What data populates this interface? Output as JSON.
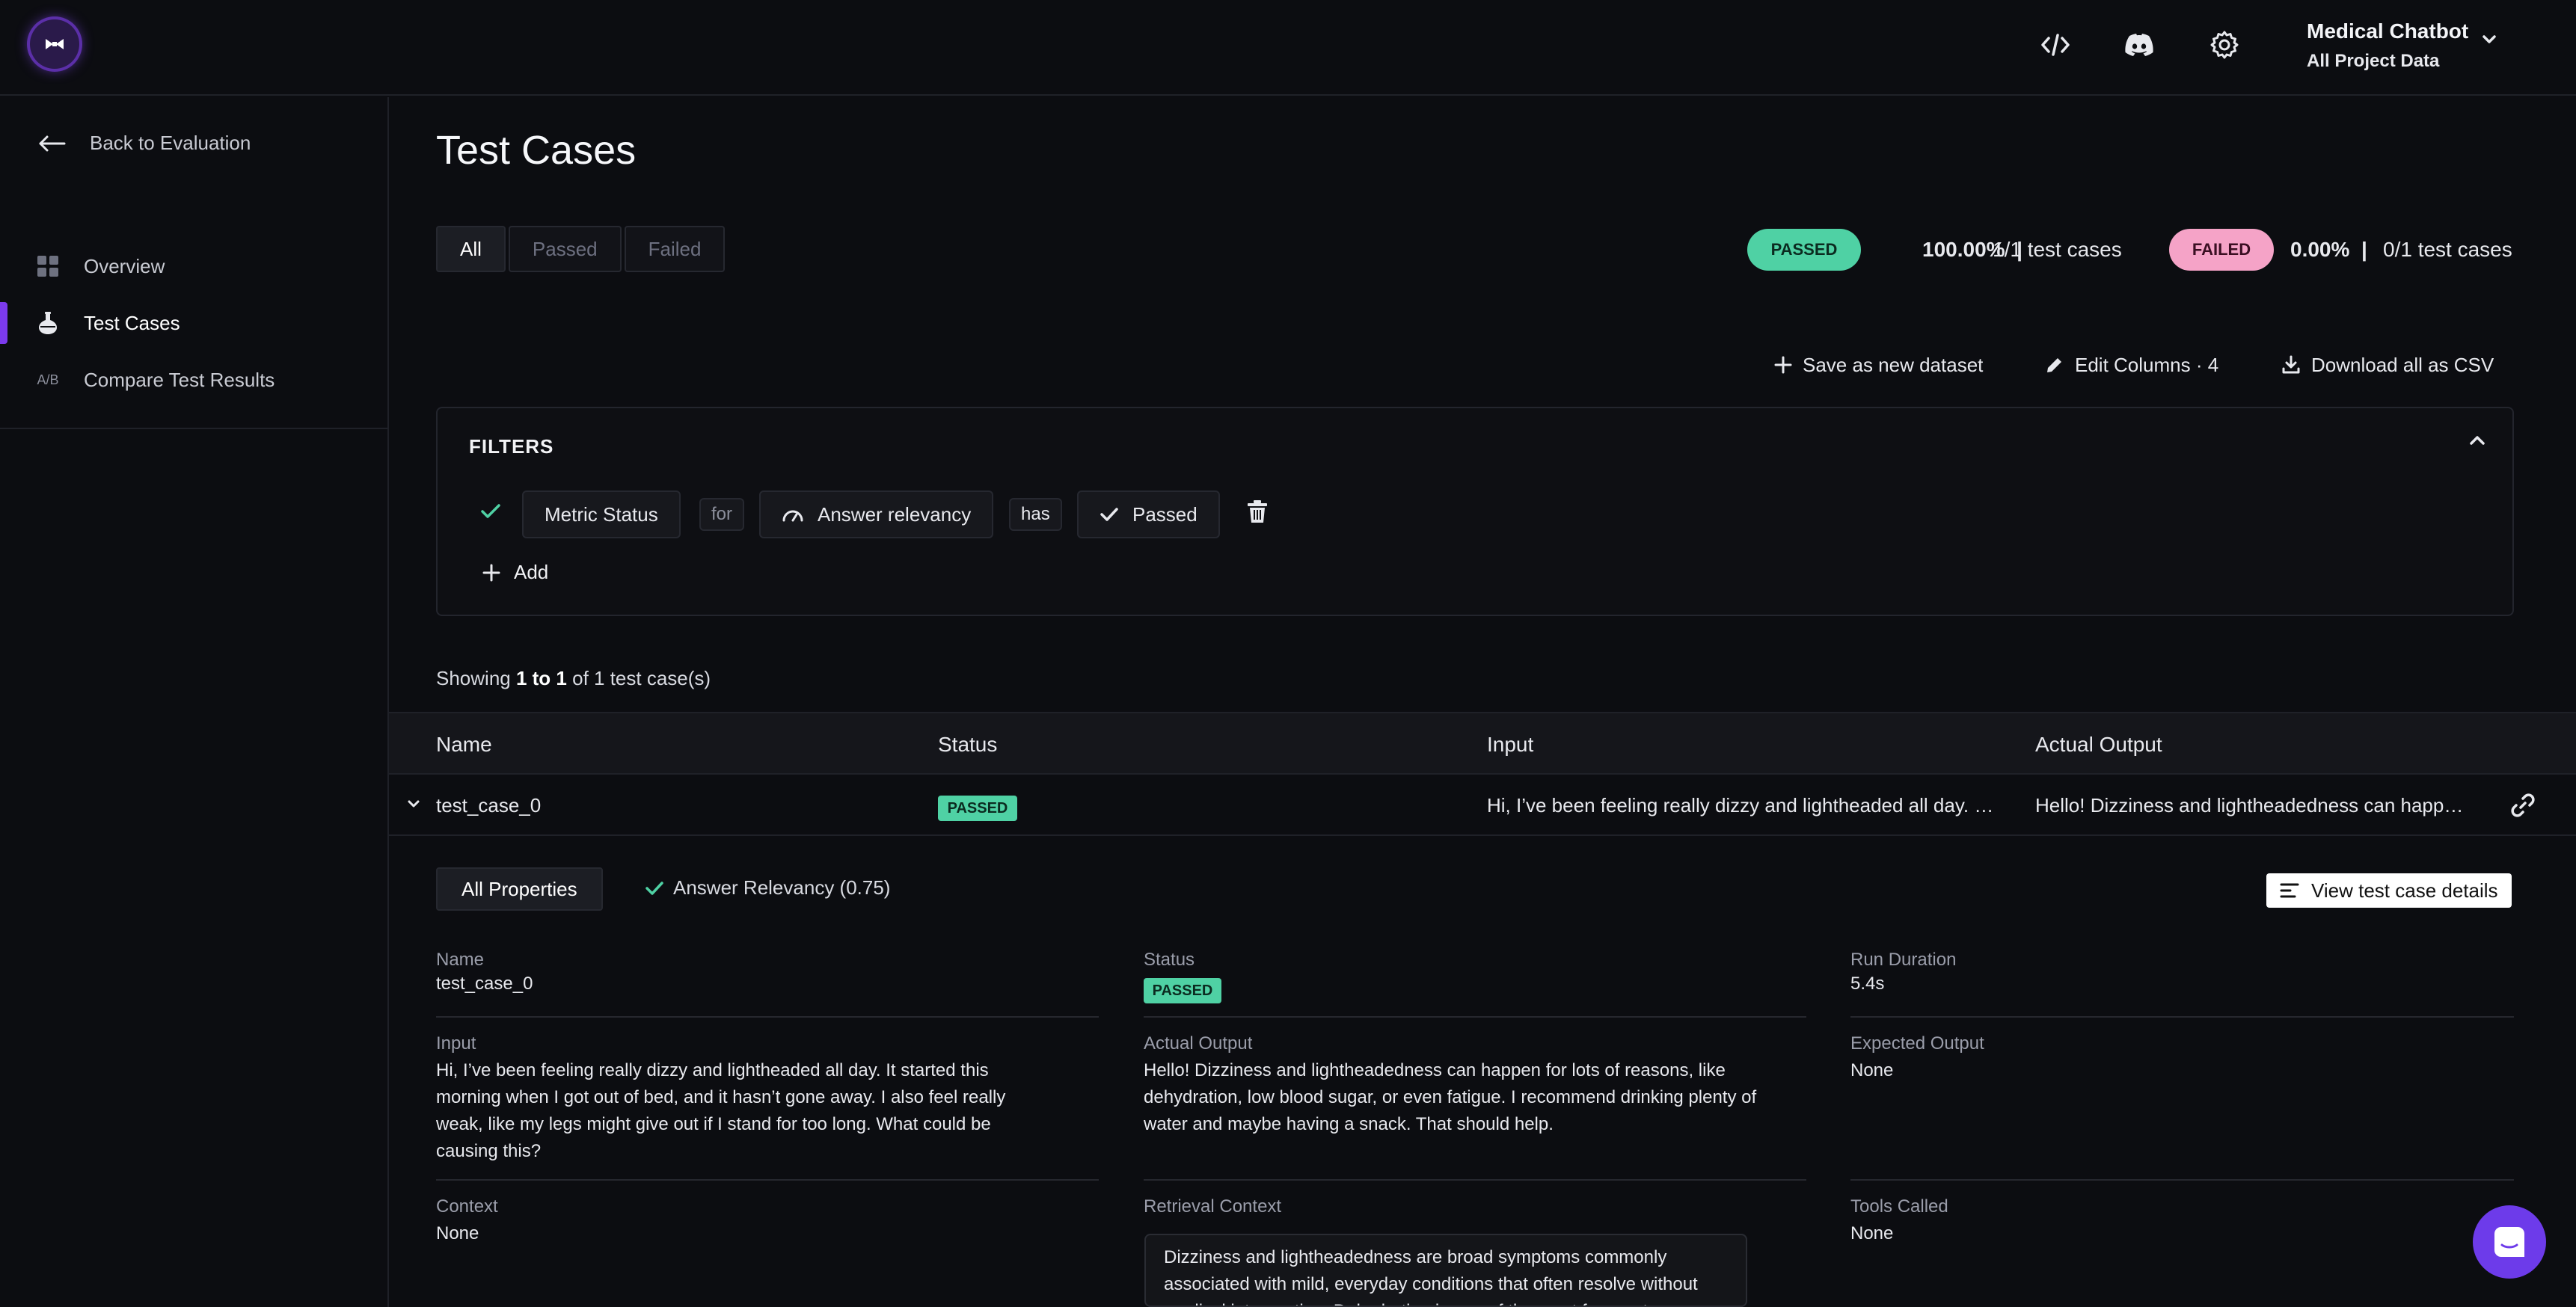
{
  "topbar": {
    "project_name": "Medical Chatbot",
    "project_scope": "All Project Data"
  },
  "sidebar": {
    "back_label": "Back to Evaluation",
    "items": [
      {
        "label": "Overview",
        "icon": "grid-icon"
      },
      {
        "label": "Test Cases",
        "icon": "flask-icon",
        "active": true
      },
      {
        "label": "Compare Test Results",
        "icon": "ab-icon",
        "icon_text": "A/B"
      }
    ]
  },
  "page": {
    "title": "Test Cases"
  },
  "tabs": [
    {
      "label": "All",
      "active": true
    },
    {
      "label": "Passed"
    },
    {
      "label": "Failed"
    }
  ],
  "summary": {
    "passed_badge": "PASSED",
    "passed_pct": "100.00%",
    "passed_count": "1/1 test cases",
    "failed_badge": "FAILED",
    "failed_pct": "0.00%",
    "failed_count": "0/1 test cases",
    "separator": "|"
  },
  "actions": {
    "save_dataset": "Save as new dataset",
    "edit_columns": "Edit Columns · 4",
    "download_csv": "Download all as CSV"
  },
  "filters": {
    "title": "FILTERS",
    "field": "Metric Status",
    "for_word": "for",
    "metric": "Answer relevancy",
    "has_word": "has",
    "value": "Passed",
    "add_label": "Add"
  },
  "showing": {
    "prefix": "Showing ",
    "range": "1 to 1",
    "suffix": " of 1 test case(s)"
  },
  "table": {
    "columns": [
      "Name",
      "Status",
      "Input",
      "Actual Output"
    ],
    "rows": [
      {
        "name": "test_case_0",
        "status": "PASSED",
        "input": "Hi, I’ve been feeling really dizzy and lightheaded all day. It started this morning when I got out of bed, and it hasn’t gone away.",
        "output": "Hello! Dizziness and lightheadedness can happen for lots of reasons, like dehydration, low blood sugar, or even fatigue."
      }
    ]
  },
  "details": {
    "tab_all": "All Properties",
    "tab_metric": "Answer Relevancy (0.75)",
    "view_button": "View test case details",
    "name_label": "Name",
    "name_value": "test_case_0",
    "status_label": "Status",
    "status_value": "PASSED",
    "duration_label": "Run Duration",
    "duration_value": "5.4s",
    "input_label": "Input",
    "input_value": "Hi, I’ve been feeling really dizzy and lightheaded all day. It started this morning when I got out of bed, and it hasn’t gone away. I also feel really weak, like my legs might give out if I stand for too long. What could be causing this?",
    "output_label": "Actual Output",
    "output_value": "Hello! Dizziness and lightheadedness can happen for lots of reasons, like dehydration, low blood sugar, or even fatigue. I recommend drinking plenty of water and maybe having a snack. That should help.",
    "expected_label": "Expected Output",
    "expected_value": "None",
    "context_label": "Context",
    "context_value": "None",
    "retrieval_label": "Retrieval Context",
    "retrieval_value": "Dizziness and lightheadedness are broad symptoms commonly associated with mild, everyday conditions that often resolve without medical intervention. Dehydration is one of the most frequent causes",
    "tools_label": "Tools Called",
    "tools_value": "None"
  },
  "colors": {
    "accent": "#7c3aed",
    "passed": "#4fd1a4",
    "failed": "#f5a3c7",
    "background": "#0c0d11"
  }
}
